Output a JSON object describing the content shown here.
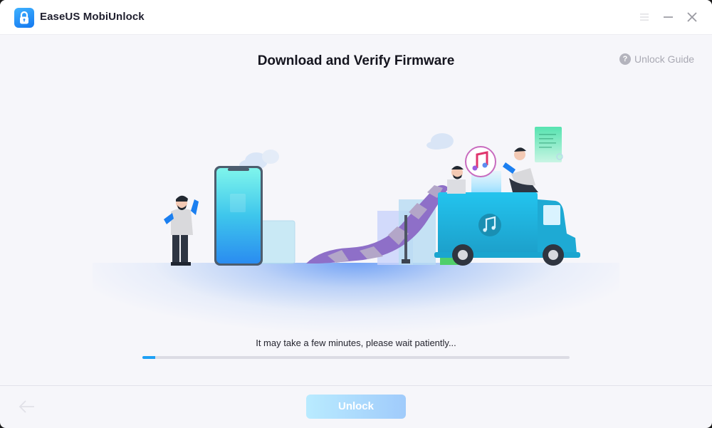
{
  "app": {
    "title": "EaseUS MobiUnlock",
    "logo_icon": "padlock-icon"
  },
  "window_controls": {
    "menu_icon": "hamburger-menu-icon",
    "minimize_icon": "minimize-icon",
    "close_icon": "close-icon"
  },
  "header": {
    "title": "Download and Verify Firmware",
    "guide_label": "Unlock Guide",
    "guide_icon": "question-circle-icon"
  },
  "illustration": {
    "description": "Person beside phone; slide leading to truck with music icon; two people on truck; firmware scroll document",
    "elements": [
      "person-waving",
      "smartphone",
      "cloud",
      "slide-ramp",
      "music-badge",
      "delivery-truck",
      "person-on-truck",
      "person-in-truck",
      "document-scroll"
    ]
  },
  "progress": {
    "message": "It may take a few minutes, please wait patiently...",
    "percent": 3
  },
  "footer": {
    "back_icon": "arrow-left-icon",
    "unlock_label": "Unlock"
  },
  "colors": {
    "accent": "#1ea0f5",
    "button_gradient_start": "#b9ebff",
    "button_gradient_end": "#a0cbfb",
    "background": "#f6f6fa"
  }
}
